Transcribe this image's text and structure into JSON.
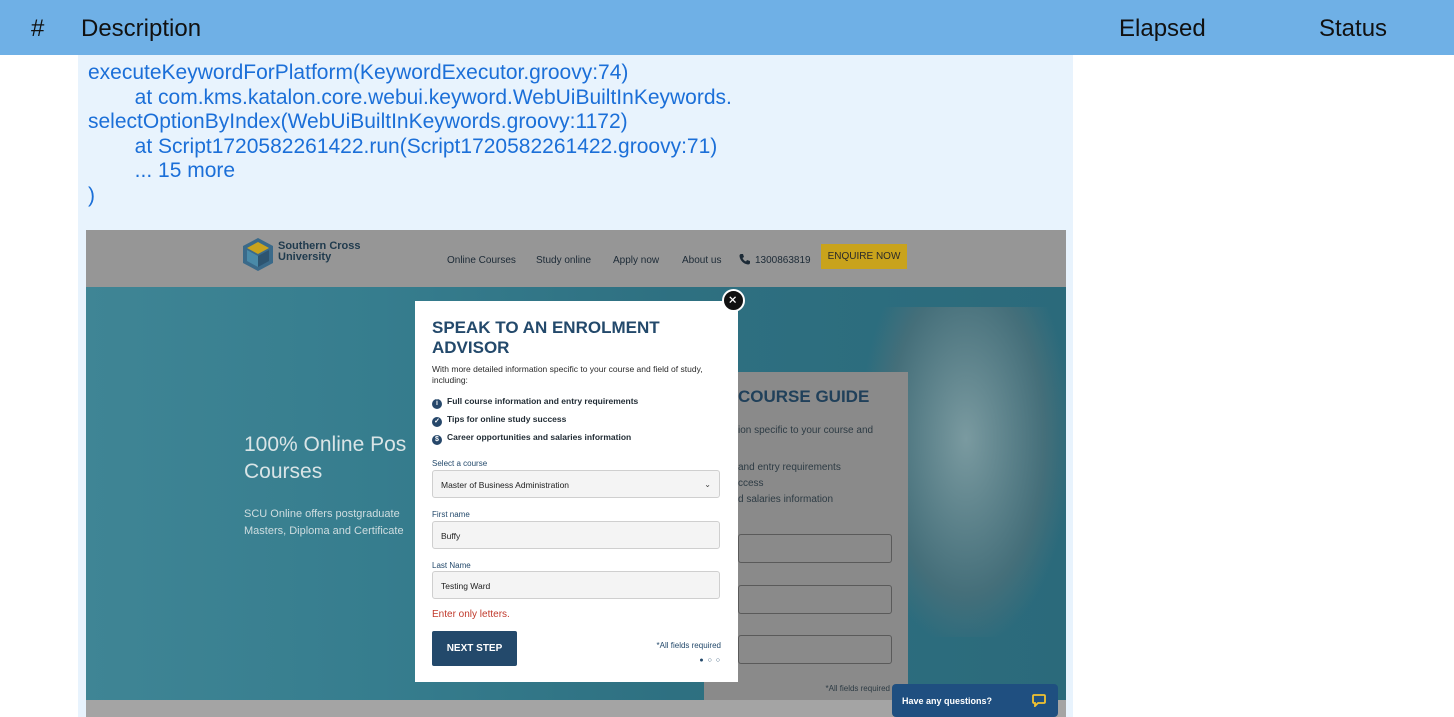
{
  "report_header": {
    "num": "#",
    "description": "Description",
    "elapsed": "Elapsed",
    "status": "Status"
  },
  "log": {
    "lines": "executeKeywordForPlatform(KeywordExecutor.groovy:74)\n        at com.kms.katalon.core.webui.keyword.WebUiBuiltInKeywords.\nselectOptionByIndex(WebUiBuiltInKeywords.groovy:1172)\n        at Script1720582261422.run(Script1720582261422.groovy:71)\n        ... 15 more\n)"
  },
  "site": {
    "logo_text": "Southern Cross\nUniversity",
    "nav": {
      "online_courses": "Online Courses",
      "study_online": "Study online",
      "apply_now": "Apply now",
      "about_us": "About us",
      "phone": "1300863819",
      "enquire": "ENQUIRE NOW"
    },
    "hero": {
      "title": "100% Online Pos\nCourses",
      "subtitle": "SCU Online offers postgraduate\nMasters, Diploma and Certificate"
    },
    "guide_card": {
      "title": "COURSE GUIDE",
      "line1": "ion specific to your course and",
      "line2": "and entry requirements",
      "line3": "ccess",
      "line4": "d salaries information",
      "required": "*All fields required",
      "dots": "● ○ ○"
    },
    "chat": {
      "label": "Have any questions?"
    }
  },
  "modal": {
    "title": "SPEAK TO AN ENROLMENT ADVISOR",
    "intro": "With more detailed information specific to your course and field of study, including:",
    "bullets": [
      {
        "icon": "i",
        "text": "Full course information and entry requirements"
      },
      {
        "icon": "✓",
        "text": "Tips for online study success"
      },
      {
        "icon": "$",
        "text": "Career opportunities and salaries information"
      }
    ],
    "course_label": "Select a course",
    "course_value": "Master of Business Administration",
    "first_name_label": "First name",
    "first_name_value": "Buffy",
    "last_name_label": "Last Name",
    "last_name_value": "Testing Ward",
    "error": "Enter only letters.",
    "next_label": "NEXT STEP",
    "required": "*All fields required",
    "dots": "● ○ ○"
  },
  "colors": {
    "header_bg": "#6fb0e6",
    "log_text": "#1b6fd8",
    "modal_accent": "#23496b",
    "error": "#c0392b",
    "enquire_bg": "#c9a31c"
  }
}
